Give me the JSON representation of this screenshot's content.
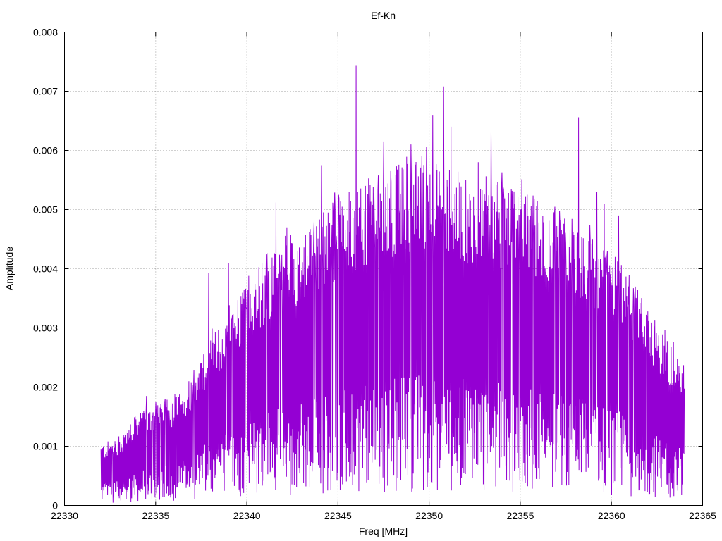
{
  "chart_data": {
    "type": "line",
    "title": "Ef-Kn",
    "xlabel": "Freq [MHz]",
    "ylabel": "Amplitude",
    "xlim": [
      22330,
      22365
    ],
    "ylim": [
      0,
      0.008
    ],
    "x_ticks": [
      "22330",
      "22335",
      "22340",
      "22345",
      "22350",
      "22355",
      "22360",
      "22365"
    ],
    "y_ticks": [
      "0",
      "0.001",
      "0.002",
      "0.003",
      "0.004",
      "0.005",
      "0.006",
      "0.007",
      "0.008"
    ],
    "grid": true,
    "series": [
      {
        "color": "#9400d3",
        "x_start": 22332.0,
        "x_end": 22364.0,
        "envelope": [
          [
            22332.0,
            0.0008
          ],
          [
            22333.0,
            0.0009
          ],
          [
            22334.0,
            0.0012
          ],
          [
            22335.0,
            0.0013
          ],
          [
            22336.0,
            0.0014
          ],
          [
            22337.0,
            0.0017
          ],
          [
            22338.0,
            0.0022
          ],
          [
            22339.0,
            0.0025
          ],
          [
            22340.0,
            0.003
          ],
          [
            22341.0,
            0.0032
          ],
          [
            22342.0,
            0.0034
          ],
          [
            22343.0,
            0.0036
          ],
          [
            22344.0,
            0.0038
          ],
          [
            22345.0,
            0.004
          ],
          [
            22346.0,
            0.0042
          ],
          [
            22347.0,
            0.0043
          ],
          [
            22348.0,
            0.0044
          ],
          [
            22349.0,
            0.0045
          ],
          [
            22350.0,
            0.0045
          ],
          [
            22351.0,
            0.0044
          ],
          [
            22352.0,
            0.0043
          ],
          [
            22353.0,
            0.0043
          ],
          [
            22354.0,
            0.0042
          ],
          [
            22355.0,
            0.0041
          ],
          [
            22356.0,
            0.004
          ],
          [
            22357.0,
            0.0038
          ],
          [
            22358.0,
            0.0037
          ],
          [
            22359.0,
            0.0035
          ],
          [
            22360.0,
            0.0033
          ],
          [
            22361.0,
            0.003
          ],
          [
            22362.0,
            0.0026
          ],
          [
            22363.0,
            0.0022
          ],
          [
            22364.0,
            0.0019
          ]
        ],
        "peaks": [
          [
            22334.5,
            0.00185
          ],
          [
            22337.9,
            0.00393
          ],
          [
            22339.0,
            0.0041
          ],
          [
            22341.6,
            0.00512
          ],
          [
            22342.2,
            0.0047
          ],
          [
            22343.7,
            0.0048
          ],
          [
            22344.1,
            0.00575
          ],
          [
            22345.3,
            0.0043
          ],
          [
            22346.0,
            0.00744
          ],
          [
            22346.5,
            0.0054
          ],
          [
            22347.5,
            0.00615
          ],
          [
            22348.4,
            0.005
          ],
          [
            22349.0,
            0.0061
          ],
          [
            22349.6,
            0.0059
          ],
          [
            22350.2,
            0.0066
          ],
          [
            22350.8,
            0.00708
          ],
          [
            22351.2,
            0.0064
          ],
          [
            22352.0,
            0.0055
          ],
          [
            22352.7,
            0.0058
          ],
          [
            22353.4,
            0.0063
          ],
          [
            22354.1,
            0.0052
          ],
          [
            22354.7,
            0.0051
          ],
          [
            22356.1,
            0.0045
          ],
          [
            22358.2,
            0.00656
          ],
          [
            22359.2,
            0.0053
          ],
          [
            22359.6,
            0.0051
          ],
          [
            22360.4,
            0.0049
          ],
          [
            22361.3,
            0.0037
          ]
        ]
      }
    ]
  }
}
